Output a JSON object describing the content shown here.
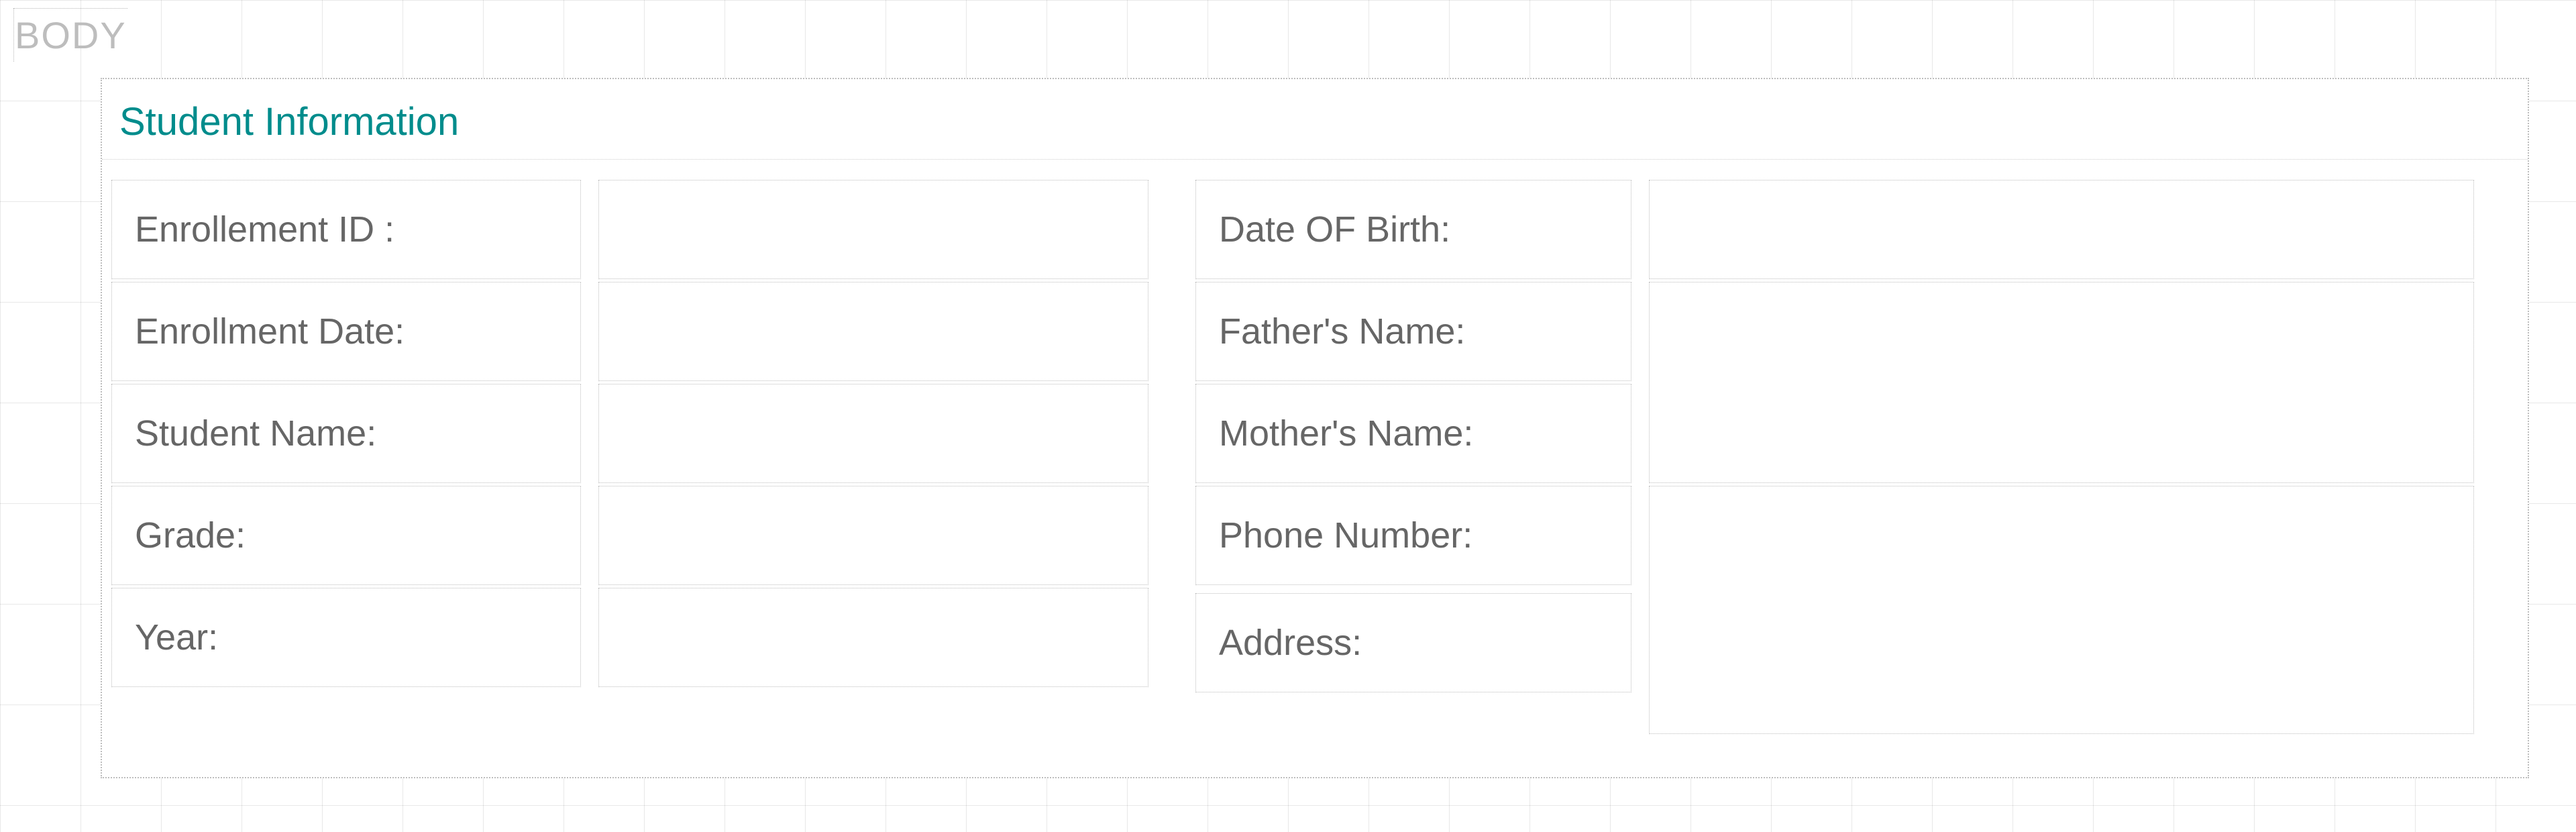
{
  "designer": {
    "body_tag": "BODY"
  },
  "section": {
    "title": "Student Information",
    "left": {
      "fields": [
        {
          "label": "Enrollement ID :",
          "value": ""
        },
        {
          "label": "Enrollment Date:",
          "value": ""
        },
        {
          "label": "Student Name:",
          "value": ""
        },
        {
          "label": "Grade:",
          "value": ""
        },
        {
          "label": "Year:",
          "value": ""
        }
      ]
    },
    "right": {
      "fields": [
        {
          "label": "Date OF Birth:",
          "value": ""
        },
        {
          "label": "Father's Name:",
          "value": ""
        },
        {
          "label": "Mother's Name:",
          "value": ""
        },
        {
          "label": "Phone Number:",
          "value": ""
        },
        {
          "label": "Address:",
          "value": ""
        }
      ]
    }
  }
}
